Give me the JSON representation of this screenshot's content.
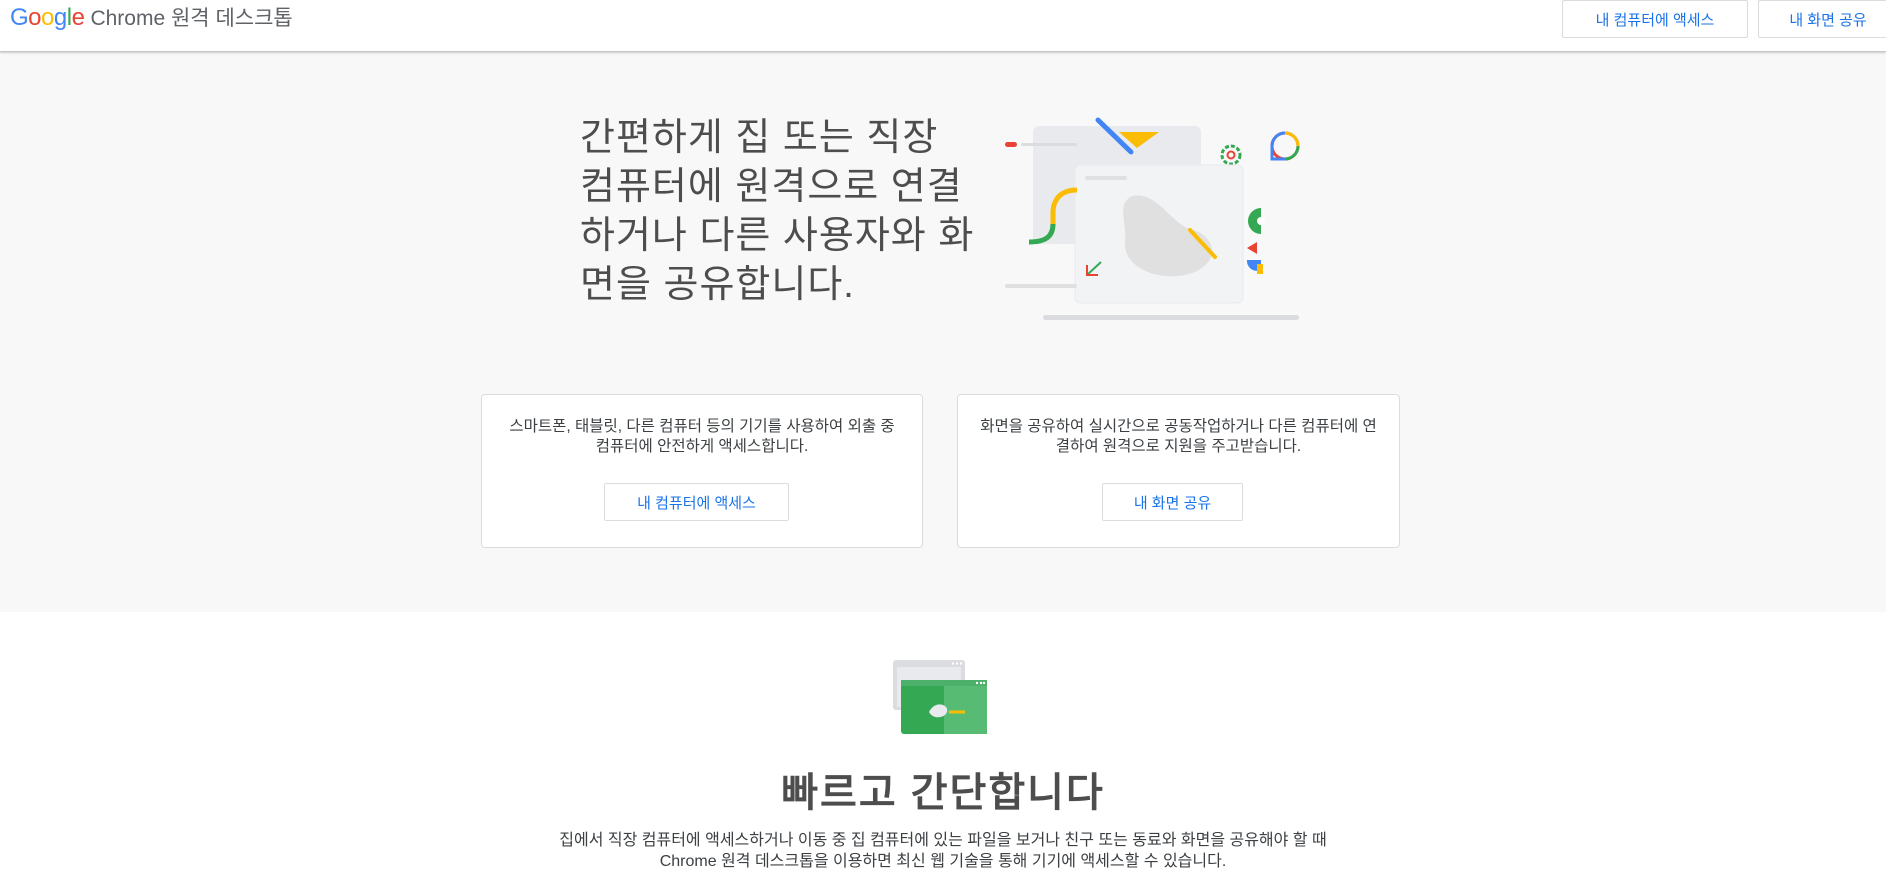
{
  "header": {
    "logo_google": "Google",
    "logo_product": "Chrome 원격 데스크톱",
    "access_button": "내 컴퓨터에 액세스",
    "share_button": "내 화면 공유"
  },
  "hero": {
    "title": "간편하게 집 또는 직장 컴퓨터에 원격으로 연결하거나 다른 사용자와 화면을 공유합니다."
  },
  "cards": [
    {
      "text": "스마트폰, 태블릿, 다른 컴퓨터 등의 기기를 사용하여 외출 중 컴퓨터에 안전하게 액세스합니다.",
      "button": "내 컴퓨터에 액세스"
    },
    {
      "text": "화면을 공유하여 실시간으로 공동작업하거나 다른 컴퓨터에 연결하여 원격으로 지원을 주고받습니다.",
      "button": "내 화면 공유"
    }
  ],
  "feature": {
    "title": "빠르고 간단합니다",
    "description": "집에서 직장 컴퓨터에 액세스하거나 이동 중 집 컴퓨터에 있는 파일을 보거나 친구 또는 동료와 화면을 공유해야 할 때 Chrome 원격 데스크톱을 이용하면 최신 웹 기술을 통해 기기에 액세스할 수 있습니다."
  },
  "colors": {
    "accent": "#1a73e8",
    "google_blue": "#4285f4",
    "google_red": "#ea4335",
    "google_yellow": "#fbbc05",
    "google_green": "#34a853",
    "hero_bg": "#f8f8f8"
  },
  "icons": {
    "hero_illustration": "remote-desktop-illustration",
    "feature_icon": "screen-share-icon"
  }
}
